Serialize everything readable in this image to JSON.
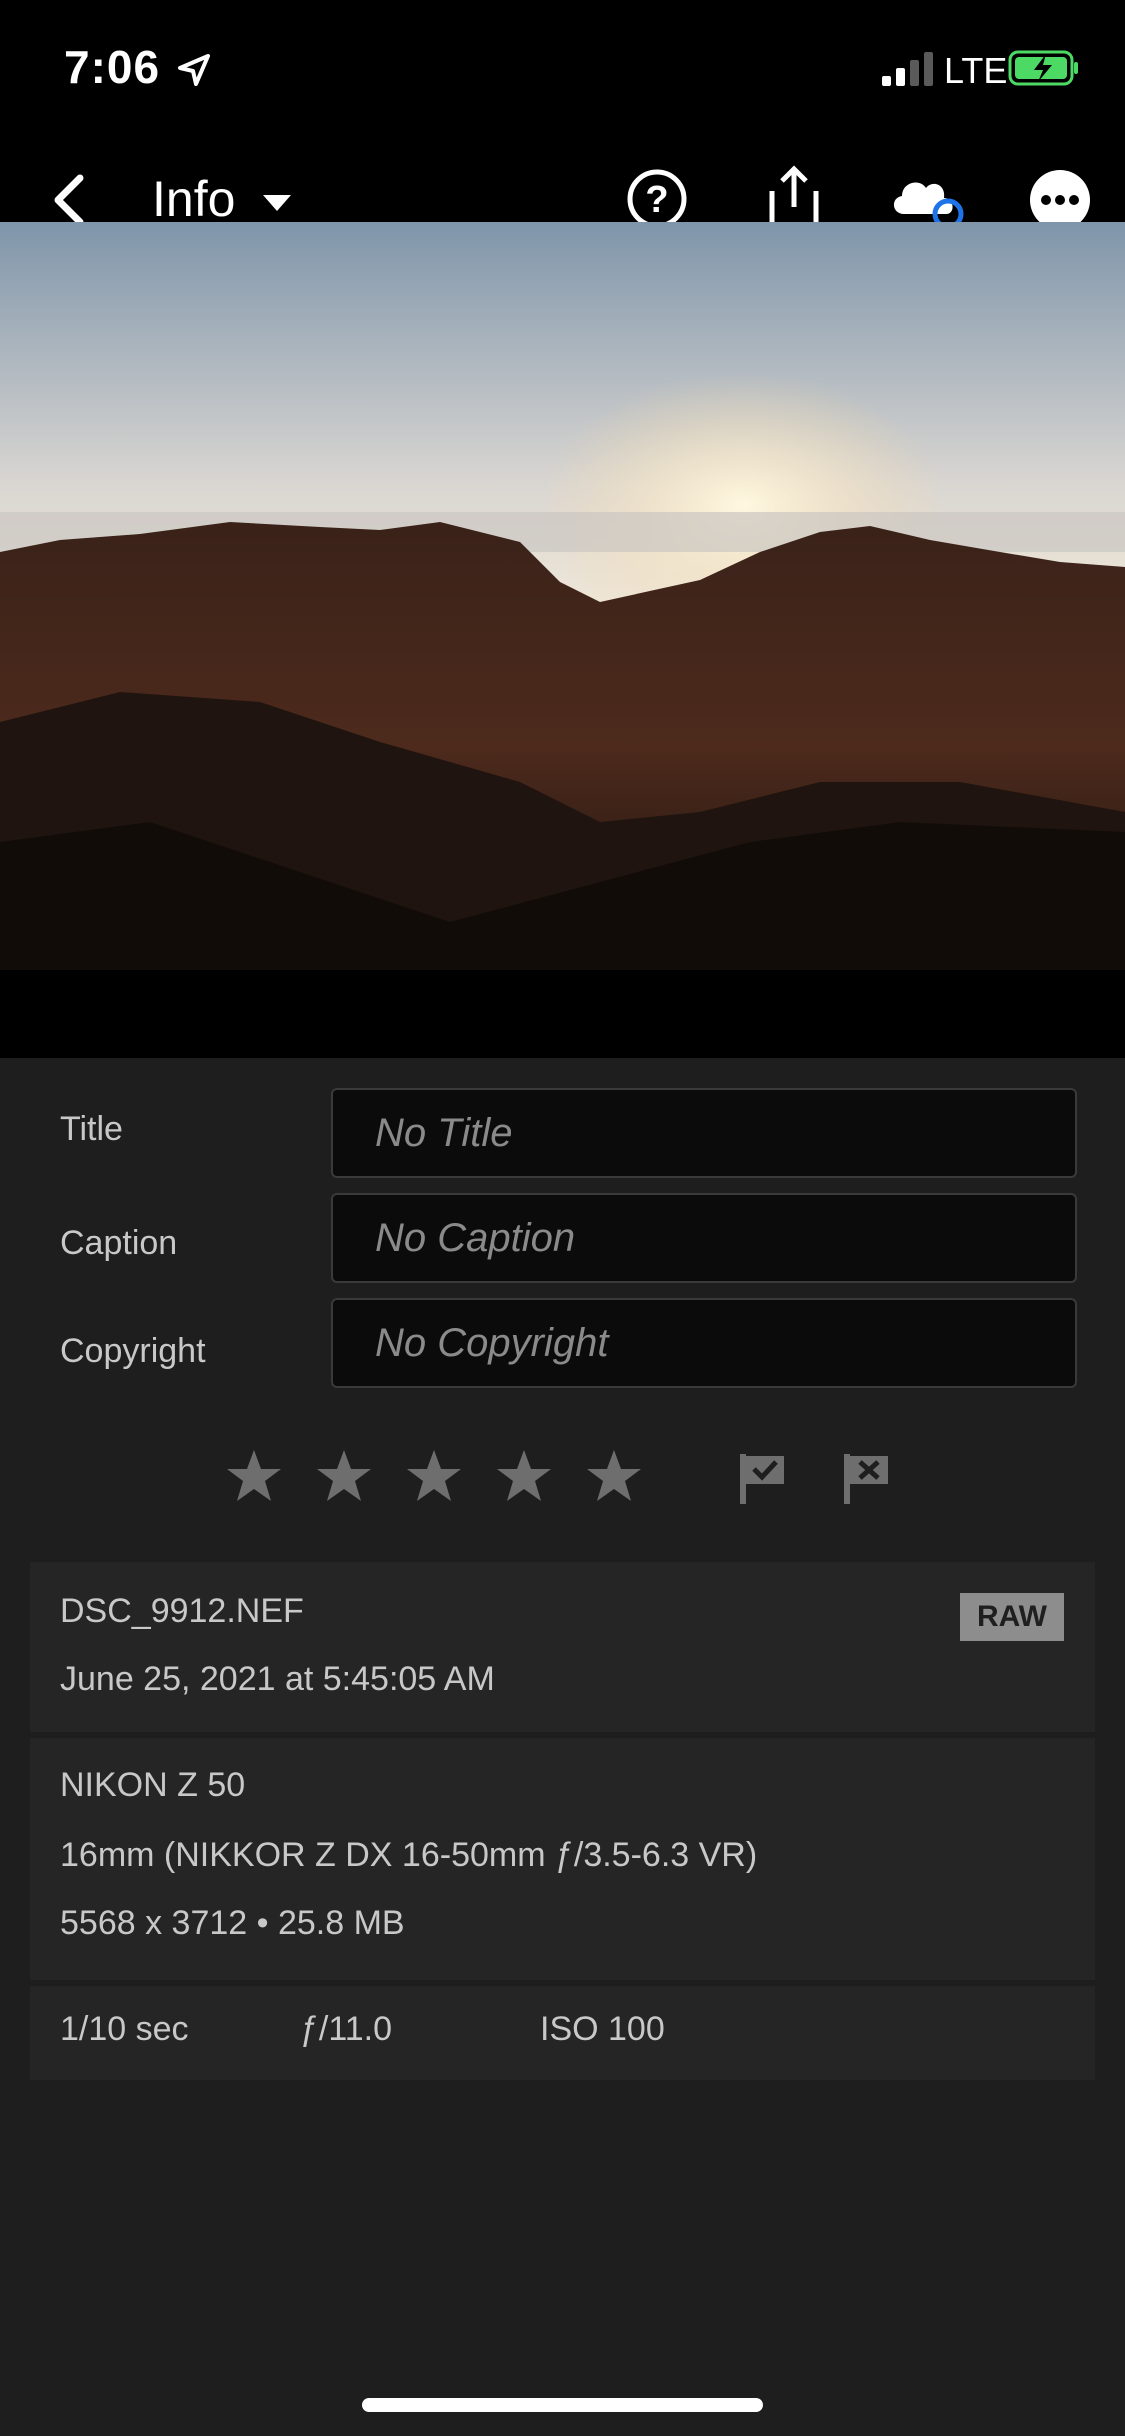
{
  "status_bar": {
    "time": "7:06",
    "network": "LTE",
    "icons": [
      "location-arrow-icon",
      "signal-icon",
      "battery-charging-icon"
    ]
  },
  "nav": {
    "back_icon": "chevron-left-icon",
    "title": "Info",
    "title_dropdown_icon": "caret-down-icon",
    "actions": [
      "help-icon",
      "share-icon",
      "cloud-sync-icon",
      "more-icon"
    ]
  },
  "metadata": {
    "title_label": "Title",
    "title_placeholder": "No Title",
    "caption_label": "Caption",
    "caption_placeholder": "No Caption",
    "copyright_label": "Copyright",
    "copyright_placeholder": "No Copyright"
  },
  "rating": {
    "stars_filled": 0,
    "stars_total": 5,
    "flags": [
      "pick-flag-icon",
      "reject-flag-icon"
    ]
  },
  "file": {
    "name": "DSC_9912.NEF",
    "date": "June 25, 2021 at 5:45:05 AM",
    "badge": "RAW"
  },
  "camera": {
    "model": "NIKON Z 50",
    "lens": "16mm (NIKKOR Z DX 16-50mm ƒ/3.5-6.3 VR)",
    "dimensions": "5568 x 3712 • 25.8 MB"
  },
  "exposure": {
    "shutter": "1/10 sec",
    "aperture": "ƒ/11.0",
    "iso": "ISO 100"
  },
  "colors": {
    "accent_blue": "#1e73e8",
    "battery_green": "#4cd964",
    "panel_bg": "#1e1e1e",
    "card_bg": "#252525"
  }
}
